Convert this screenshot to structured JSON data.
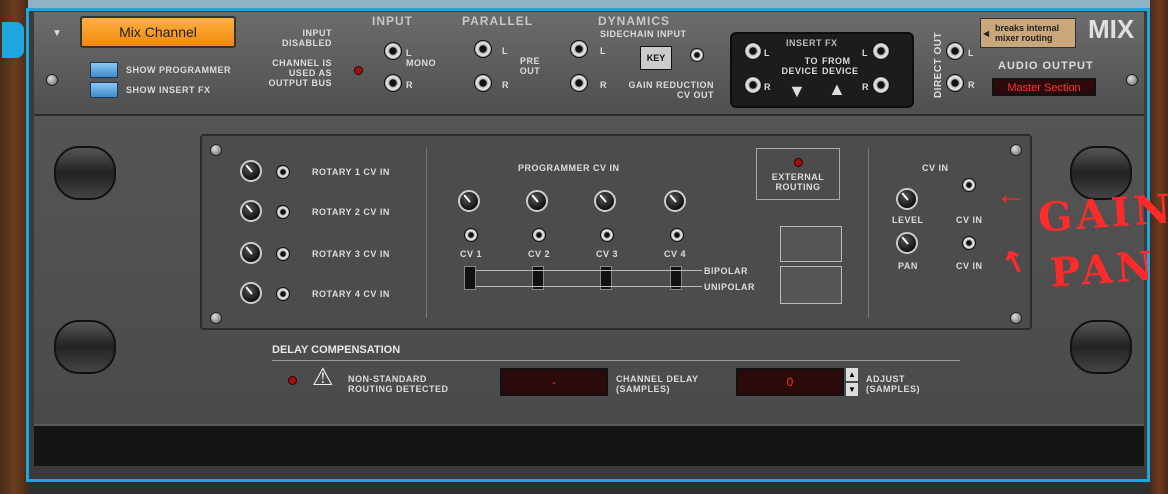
{
  "header": {
    "device_name": "Mix Channel",
    "title": "MIX",
    "breaks_routing": "breaks internal mixer routing",
    "audio_output_label": "AUDIO OUTPUT",
    "audio_output_value": "Master Section"
  },
  "buttons": {
    "show_programmer": "SHOW PROGRAMMER",
    "show_insert_fx": "SHOW INSERT FX"
  },
  "input": {
    "title": "INPUT",
    "disabled": "INPUT DISABLED",
    "bus_note": "CHANNEL IS USED AS OUTPUT BUS",
    "mono": "MONO",
    "l": "L",
    "r": "R"
  },
  "parallel": {
    "title": "PARALLEL",
    "pre_out": "PRE OUT",
    "l": "L",
    "r": "R"
  },
  "dynamics": {
    "title": "DYNAMICS",
    "sidechain": "SIDECHAIN INPUT",
    "key": "KEY",
    "gain_reduction": "GAIN REDUCTION CV OUT",
    "l": "L",
    "r": "R"
  },
  "insert": {
    "title": "INSERT FX",
    "to_device": "TO DEVICE",
    "from_device": "FROM DEVICE",
    "l": "L",
    "r": "R"
  },
  "direct_out": {
    "title": "DIRECT OUT",
    "l": "L",
    "r": "R"
  },
  "rotary": [
    "ROTARY 1  CV IN",
    "ROTARY 2  CV IN",
    "ROTARY 3  CV IN",
    "ROTARY 4  CV IN"
  ],
  "programmer": {
    "title": "PROGRAMMER  CV IN",
    "cvs": [
      "CV 1",
      "CV 2",
      "CV 3",
      "CV 4"
    ],
    "bipolar": "BIPOLAR",
    "unipolar": "UNIPOLAR"
  },
  "external_routing": "EXTERNAL ROUTING",
  "level_pan": {
    "cv_in_header": "CV IN",
    "level": "LEVEL",
    "pan": "PAN",
    "cv_in": "CV IN"
  },
  "delay": {
    "title": "DELAY COMPENSATION",
    "nonstandard": "NON-STANDARD ROUTING DETECTED",
    "channel_delay_value": "-",
    "channel_delay_label": "CHANNEL DELAY (SAMPLES)",
    "adjust_value": "0",
    "adjust_label": "ADJUST (SAMPLES)"
  },
  "annotations": {
    "gain": "GAIN",
    "pan": "PAN"
  }
}
